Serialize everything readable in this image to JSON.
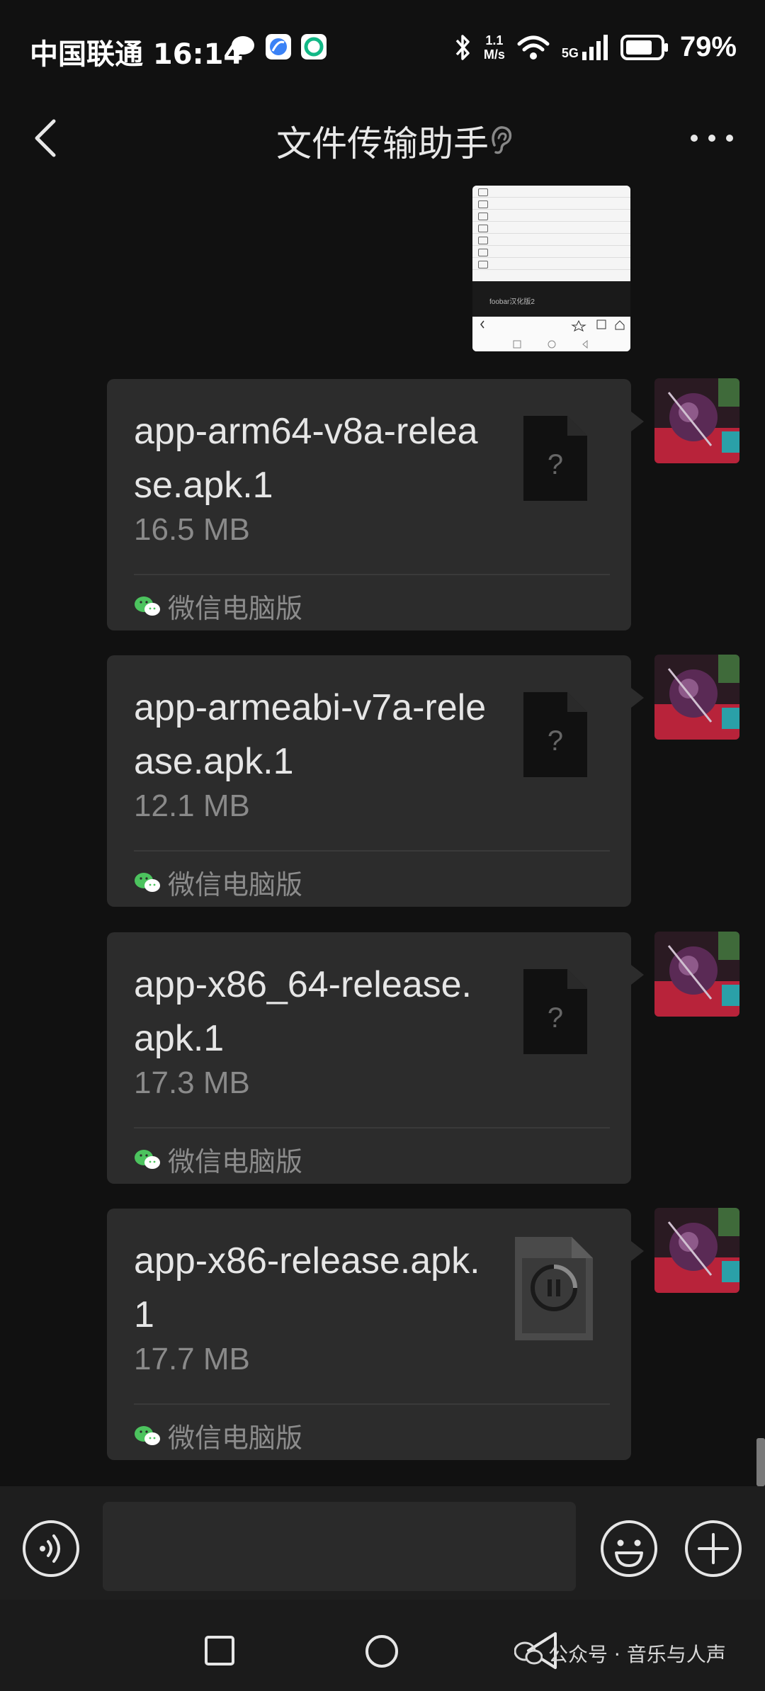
{
  "status_bar": {
    "carrier_time": "中国联通 16:14",
    "net_speed_value": "1.1",
    "net_speed_unit": "M/s",
    "network": "5G",
    "battery": "79%"
  },
  "header": {
    "title": "文件传输助手"
  },
  "screenshot_message": {
    "caption": "foobar汉化版2"
  },
  "messages": [
    {
      "file_name": "app-arm64-v8a-release.apk.1",
      "size": "16.5 MB",
      "source": "微信电脑版",
      "status": "unknown-file"
    },
    {
      "file_name": "app-armeabi-v7a-release.apk.1",
      "size": "12.1 MB",
      "source": "微信电脑版",
      "status": "unknown-file"
    },
    {
      "file_name": "app-x86_64-release.apk.1",
      "size": "17.3 MB",
      "source": "微信电脑版",
      "status": "unknown-file"
    },
    {
      "file_name": "app-x86-release.apk.1",
      "size": "17.7 MB",
      "source": "微信电脑版",
      "status": "paused"
    }
  ],
  "watermark": {
    "text": "公众号 · 音乐与人声"
  },
  "colors": {
    "background": "#111111",
    "bubble": "#2c2c2c",
    "wechat_green": "#4cc35e"
  },
  "icons": {
    "back": "chevron-left-icon",
    "ear": "ear-icon",
    "more": "more-icon",
    "file_unknown": "unknown-file-icon",
    "file_paused": "pause-icon",
    "voice": "voice-icon",
    "emoji": "emoji-icon",
    "plus": "plus-icon"
  }
}
